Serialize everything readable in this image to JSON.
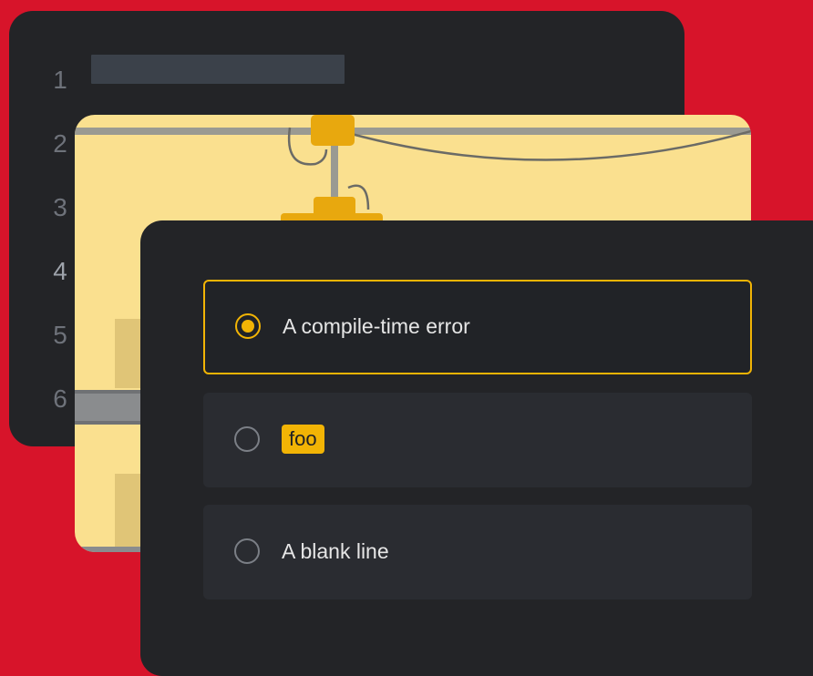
{
  "editor": {
    "line_numbers": [
      "1",
      "2",
      "3",
      "4",
      "5",
      "6"
    ],
    "active_line": "4"
  },
  "quiz": {
    "options": [
      {
        "label": "A compile-time error",
        "selected": true
      },
      {
        "label": "foo",
        "is_code": true,
        "selected": false
      },
      {
        "label": "A blank line",
        "selected": false
      }
    ]
  },
  "colors": {
    "background": "#D7142A",
    "card_dark": "#232427",
    "accent": "#F2B405",
    "illustration_bg": "#FAE08F"
  }
}
